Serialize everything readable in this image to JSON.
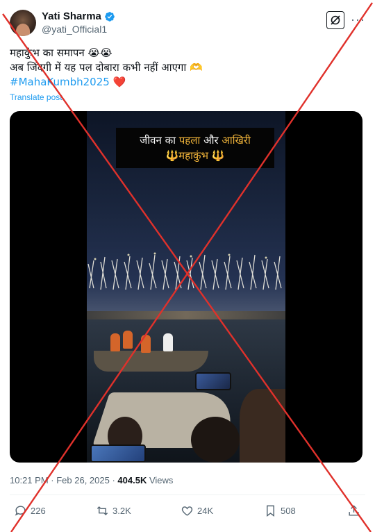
{
  "author": {
    "display_name": "Yati Sharma",
    "handle": "@yati_Official1"
  },
  "tweet": {
    "line1": "महाकुंभ का समापन 😭😭",
    "line2": "अब जिंदगी में यह पल दोबारा कभी नहीं आएगा 🫶",
    "hashtag": "#MahaKumbh2025",
    "hashtag_suffix": "❤️",
    "translate_label": "Translate post"
  },
  "video_caption": {
    "part1": "जीवन का ",
    "part2": "पहला",
    "part3": " और ",
    "part4": "आखिरी",
    "line2": "🔱महाकुंभ 🔱"
  },
  "meta": {
    "time": "10:21 PM",
    "separator": " · ",
    "date": "Feb 26, 2025",
    "dot": " · ",
    "views_count": "404.5K",
    "views_label": " Views"
  },
  "actions": {
    "replies": "226",
    "reposts": "3.2K",
    "likes": "24K",
    "bookmarks": "508"
  },
  "colors": {
    "accent": "#1d9bf0",
    "cross": "#e0312b",
    "caption_highlight": "#f2b53a"
  },
  "icons": [
    "verified-badge-icon",
    "grok-icon",
    "more-icon",
    "reply-icon",
    "repost-icon",
    "like-icon",
    "bookmark-icon",
    "share-icon"
  ]
}
